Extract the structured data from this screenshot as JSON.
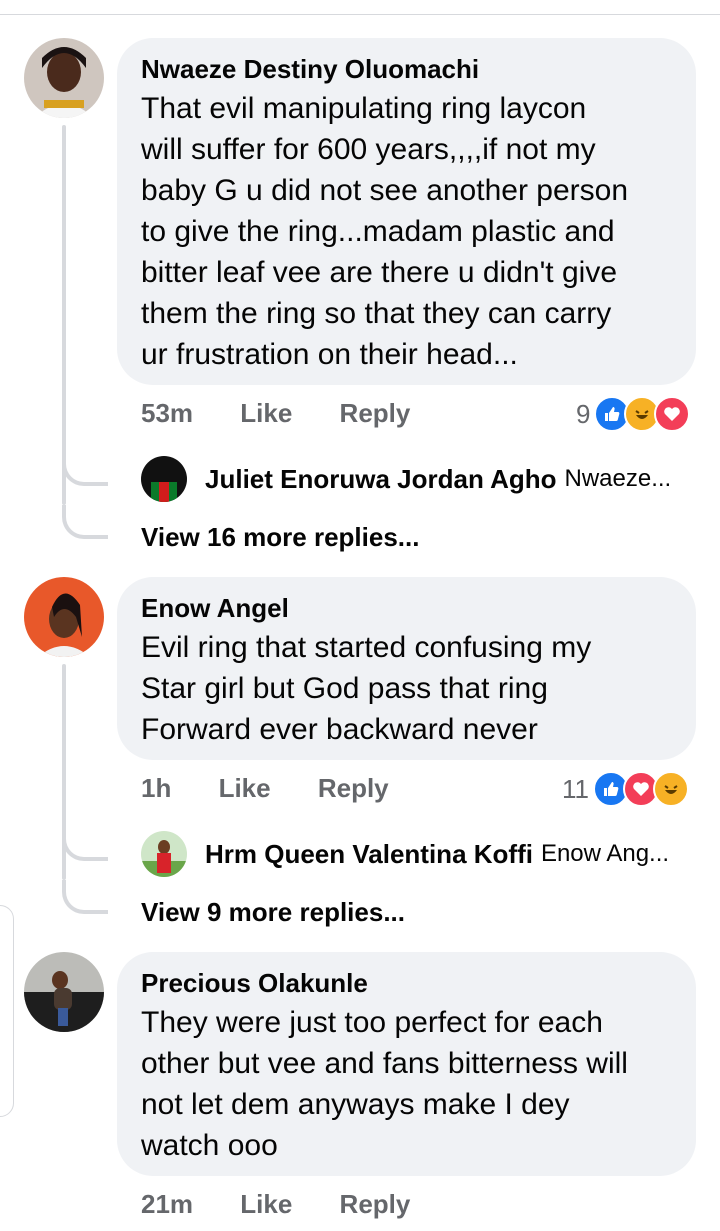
{
  "comments": [
    {
      "author": "Nwaeze Destiny Oluomachi",
      "lines": [
        "That evil manipulating ring  laycon",
        "will suffer for 600 years,,,,if not my",
        "baby G u did not see another person",
        "to give the ring...madam plastic and",
        "bitter leaf vee are there u didn't give",
        "them the ring so that they can carry",
        "ur frustration on their head..."
      ],
      "time": "53m",
      "like": "Like",
      "reply": "Reply",
      "reaction_count": "9",
      "reactions": [
        "like-icon",
        "haha-icon",
        "love-icon"
      ],
      "reply_preview": {
        "name": "Juliet Enoruwa Jordan Agho",
        "snippet": "Nwaeze..."
      },
      "more_replies": "View 16 more replies..."
    },
    {
      "author": "Enow Angel",
      "lines": [
        "Evil ring that started confusing my",
        "Star girl but God pass that ring",
        "Forward ever backward never"
      ],
      "time": "1h",
      "like": "Like",
      "reply": "Reply",
      "reaction_count": "11",
      "reactions": [
        "like-icon",
        "love-icon",
        "haha-icon"
      ],
      "reply_preview": {
        "name": "Hrm Queen Valentina Koffi",
        "snippet": "Enow Ang..."
      },
      "more_replies": "View 9 more replies..."
    },
    {
      "author": "Precious Olakunle",
      "lines": [
        "They were just too perfect for each",
        "other but vee and fans bitterness will",
        "not let dem anyways make I dey",
        "watch ooo"
      ],
      "time": "21m",
      "like": "Like",
      "reply": "Reply"
    }
  ],
  "colors": {
    "like": "#1877f2",
    "love": "#f33e58",
    "haha": "#f7b125",
    "bubble": "#f0f2f5",
    "meta": "#65676b"
  }
}
